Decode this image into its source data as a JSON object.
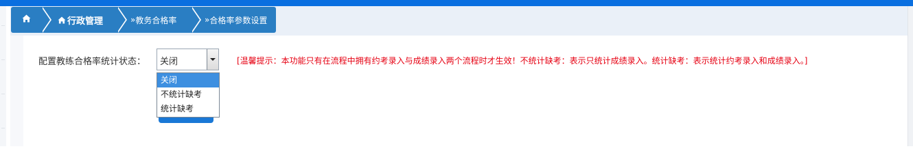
{
  "breadcrumb": {
    "home_icon": "home-icon",
    "items": [
      "行政管理",
      "教务合格率",
      "合格率参数设置"
    ],
    "chevron": "»"
  },
  "form": {
    "label": "配置教练合格率统计状态：",
    "select": {
      "current": "关闭",
      "options": [
        "关闭",
        "不统计缺考",
        "统计缺考"
      ],
      "highlighted": "关闭"
    },
    "tip": "[温馨提示：本功能只有在流程中拥有约考录入与成绩录入两个流程时才生效！不统计缺考：表示只统计成绩录入。统计缺考：表示统计约考录入和成绩录入。]"
  },
  "colors": {
    "topbar": "#0a6fe0",
    "breadcrumb": "#2a7ec3",
    "tip": "#e60012",
    "option_highlight": "#3d8fe0"
  }
}
